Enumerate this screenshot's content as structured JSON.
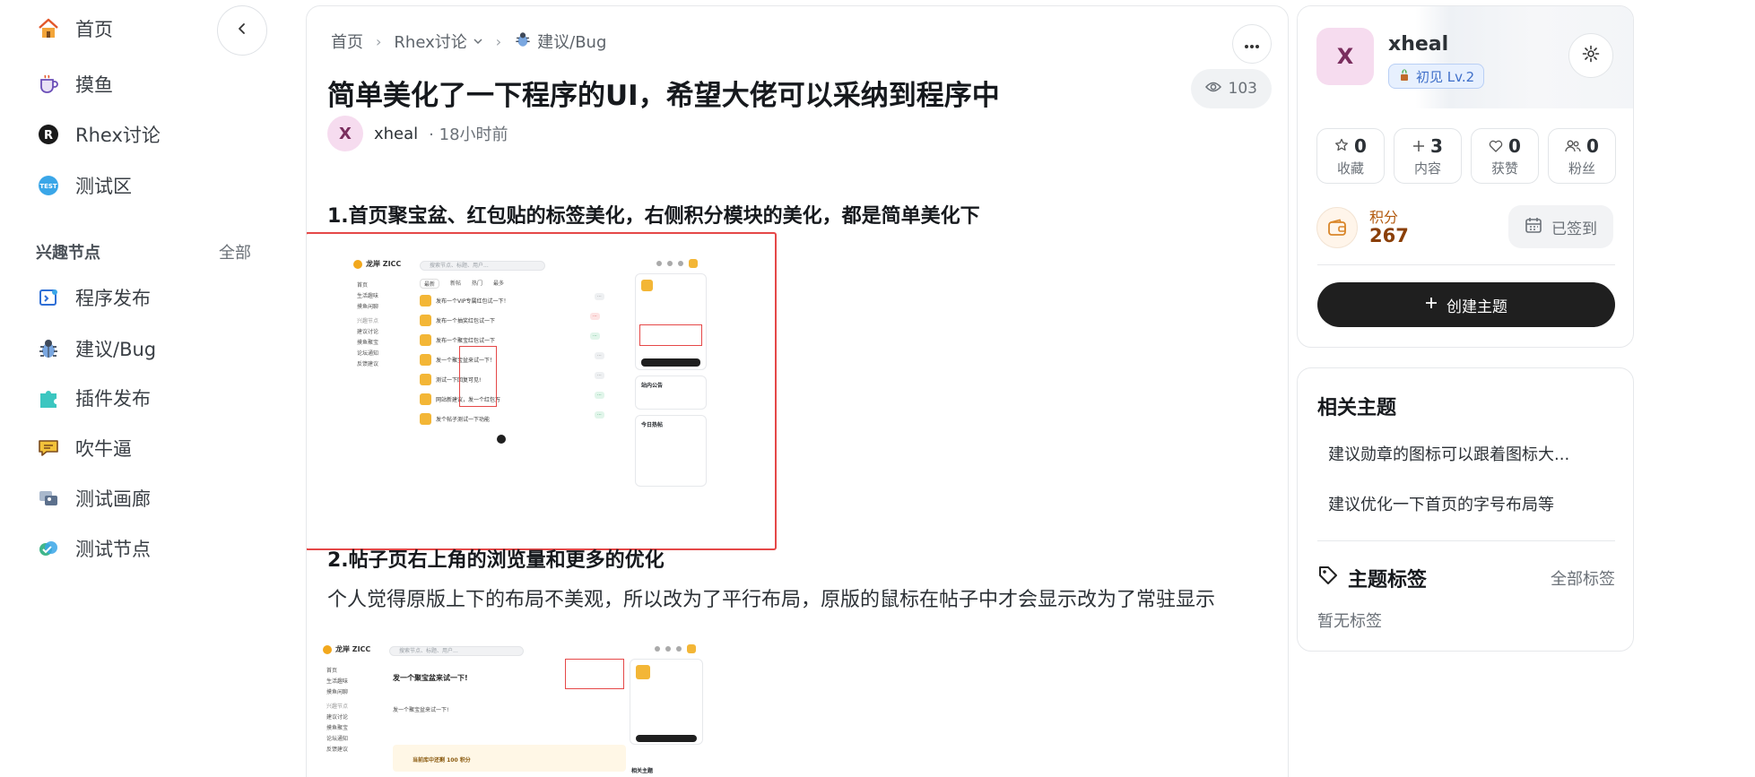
{
  "sidebar": {
    "items": [
      {
        "label": "首页",
        "icon": "house-icon"
      },
      {
        "label": "摸鱼",
        "icon": "coffee-cup-icon"
      },
      {
        "label": "Rhex讨论",
        "icon": "rhex-logo-icon"
      },
      {
        "label": "测试区",
        "icon": "test-badge-icon"
      }
    ],
    "section_title": "兴趣节点",
    "section_all": "全部",
    "nodes": [
      {
        "label": "程序发布",
        "icon": "program-icon"
      },
      {
        "label": "建议/Bug",
        "icon": "bug-icon"
      },
      {
        "label": "插件发布",
        "icon": "puzzle-icon"
      },
      {
        "label": "吹牛逼",
        "icon": "chat-bubble-icon"
      },
      {
        "label": "测试画廊",
        "icon": "gallery-icon"
      },
      {
        "label": "测试节点",
        "icon": "node-icon"
      }
    ]
  },
  "breadcrumb": {
    "home": "首页",
    "category": "Rhex讨论",
    "node": "建议/Bug"
  },
  "post": {
    "title": "简单美化了一下程序的UI，希望大佬可以采纳到程序中",
    "views": "103",
    "author_initial": "X",
    "author": "xheal",
    "time": "· 18小时前",
    "heading1": "1.首页聚宝盆、红包贴的标签美化，右侧积分模块的美化，都是简单美化下",
    "heading2": "2.帖子页右上角的浏览量和更多的优化",
    "paragraph": "个人觉得原版上下的布局不美观，所以改为了平行布局，原版的鼠标在帖子中才会显示改为了常驻显示"
  },
  "shot1": {
    "logo": "龙岸 ZICC",
    "search": "搜索节点、标题、用户...",
    "tabs": [
      "最新",
      "新帖",
      "热门",
      "最多"
    ],
    "side_nav": [
      "首页",
      "生活趣味",
      "摸鱼闲聊",
      "兴趣节点",
      "建议讨论",
      "摸鱼聚宝",
      "论坛通知",
      "反馈建议"
    ],
    "rows": [
      "发布一个VIP专属红包试一下！",
      "发布一个抽奖红包试一下",
      "发布一个聚宝红包试一下",
      "发一个聚宝盆来试一下！",
      "测试一下回复可见!",
      "网站新建议，发一个红包万",
      "发个帖子测试一下功能"
    ],
    "notice": "站内公告",
    "hot": "今日热帖"
  },
  "shot2": {
    "logo": "龙岸 ZICC",
    "search": "搜索节点、标题、用户...",
    "title": "发一个聚宝盆来试一下!",
    "body": "发一个聚宝盆来试一下!",
    "banner": "当前库中还剩 100 积分",
    "side_nav": [
      "首页",
      "生活趣味",
      "摸鱼闲聊",
      "兴趣节点",
      "建议讨论",
      "摸鱼聚宝",
      "论坛通知",
      "反馈建议"
    ],
    "related": "相关主题"
  },
  "profile": {
    "initial": "X",
    "name": "xheal",
    "level": "初见 Lv.2",
    "stats": [
      {
        "value": "0",
        "label": "收藏",
        "icon": "star-icon"
      },
      {
        "value": "3",
        "label": "内容",
        "icon": "plus-icon"
      },
      {
        "value": "0",
        "label": "获赞",
        "icon": "heart-icon"
      },
      {
        "value": "0",
        "label": "粉丝",
        "icon": "users-icon"
      }
    ],
    "points_label": "积分",
    "points": "267",
    "checkin": "已签到",
    "create": "创建主题"
  },
  "related": {
    "title": "相关主题",
    "items": [
      "建议勋章的图标可以跟着图标大...",
      "建议优化一下首页的字号布局等"
    ],
    "tags_title": "主题标签",
    "tags_all": "全部标签",
    "tags_empty": "暂无标签"
  },
  "colors": {
    "accent": "#1f1f1f",
    "avatar_bg": "#f6dcef",
    "level_bg": "#e7f0fe",
    "points": "#8a3f07",
    "highlight": "#e54848"
  }
}
